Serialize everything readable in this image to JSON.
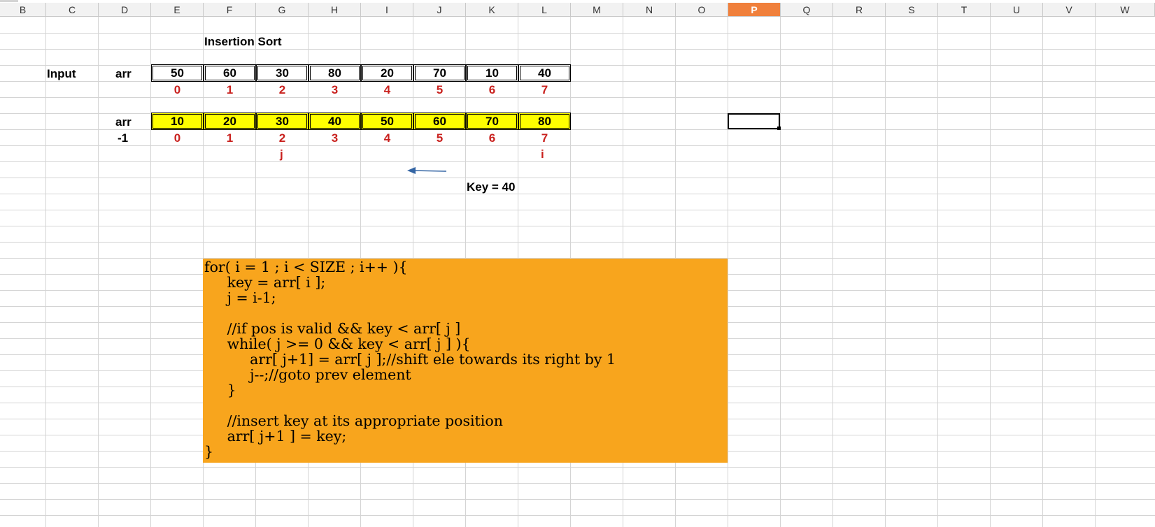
{
  "columns": [
    "B",
    "C",
    "D",
    "E",
    "F",
    "G",
    "H",
    "I",
    "J",
    "K",
    "L",
    "M",
    "N",
    "O",
    "P",
    "Q",
    "R",
    "S",
    "T",
    "U",
    "V",
    "W"
  ],
  "active_column": "P",
  "title": "Insertion Sort",
  "input_label": "Input",
  "arr_label_1": "arr",
  "input_array": [
    "50",
    "60",
    "30",
    "80",
    "20",
    "70",
    "10",
    "40"
  ],
  "indices_1": [
    "0",
    "1",
    "2",
    "3",
    "4",
    "5",
    "6",
    "7"
  ],
  "arr_label_2": "arr",
  "sorted_array": [
    "10",
    "20",
    "30",
    "40",
    "50",
    "60",
    "70",
    "80"
  ],
  "minus_one": "-1",
  "indices_2": [
    "0",
    "1",
    "2",
    "3",
    "4",
    "5",
    "6",
    "7"
  ],
  "j_label": "j",
  "i_label": "i",
  "key_text": "Key = 40",
  "arrow_color": "#3465a4",
  "highlight_color": "#ffff00",
  "code_bg": "#f8a51d",
  "code_text": "for( i = 1 ; i < SIZE ; i++ ){\n     key = arr[ i ];\n     j = i-1;\n\n     //if pos is valid && key < arr[ j ]\n     while( j >= 0 && key < arr[ j ] ){\n          arr[ j+1] = arr[ j ];//shift ele towards its right by 1\n          j--;//goto prev element\n     }\n\n     //insert key at its appropriate position\n     arr[ j+1 ] = key;\n}"
}
